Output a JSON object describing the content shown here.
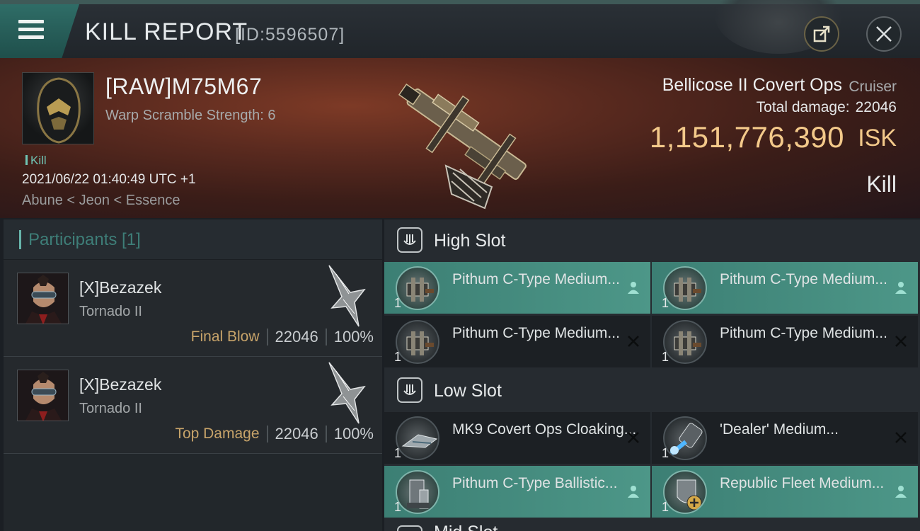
{
  "header": {
    "title": "KILL REPORT",
    "report_id": "[ID:5596507]",
    "menu_icon": "hamburger-icon",
    "share_icon": "share-icon",
    "close_icon": "close-icon"
  },
  "victim": {
    "name": "[RAW]M75M67",
    "warp_scramble": "Warp Scramble Strength: 6",
    "kill_tag": "Kill",
    "datetime": "2021/06/22 01:40:49 UTC +1",
    "corporation_path": "Abune < Jeon < Essence",
    "ship_name": "Bellicose II Covert Ops",
    "ship_class": "Cruiser",
    "total_damage_label": "Total damage:",
    "total_damage": "22046",
    "isk_value": "1,151,776,390",
    "isk_unit": "ISK",
    "result": "Kill"
  },
  "participants": {
    "header": "Participants [1]",
    "list": [
      {
        "name": "[X]Bezazek",
        "ship": "Tornado II",
        "role": "Final Blow",
        "damage": "22046",
        "percent": "100%"
      },
      {
        "name": "[X]Bezazek",
        "ship": "Tornado II",
        "role": "Top Damage",
        "damage": "22046",
        "percent": "100%"
      }
    ]
  },
  "fitting": {
    "high_slot": {
      "label": "High Slot",
      "modules": [
        {
          "name": "Pithum C-Type Medium...",
          "qty": "1",
          "state": "active",
          "icon": "turret-icon"
        },
        {
          "name": "Pithum C-Type Medium...",
          "qty": "1",
          "state": "active",
          "icon": "turret-icon"
        },
        {
          "name": "Pithum C-Type Medium...",
          "qty": "1",
          "state": "destroyed",
          "icon": "turret-icon"
        },
        {
          "name": "Pithum C-Type Medium...",
          "qty": "1",
          "state": "destroyed",
          "icon": "turret-icon"
        }
      ]
    },
    "low_slot": {
      "label": "Low Slot",
      "modules": [
        {
          "name": "MK9 Covert Ops Cloaking...",
          "qty": "1",
          "state": "destroyed",
          "icon": "cloak-icon"
        },
        {
          "name": "'Dealer' Medium...",
          "qty": "1",
          "state": "destroyed",
          "icon": "capacitor-icon"
        },
        {
          "name": "Pithum C-Type Ballistic...",
          "qty": "1",
          "state": "active",
          "icon": "ballistic-icon"
        },
        {
          "name": "Republic Fleet Medium...",
          "qty": "1",
          "state": "active",
          "icon": "armor-icon"
        }
      ]
    },
    "mid_slot": {
      "label": "Mid Slot"
    }
  },
  "colors": {
    "accent_teal": "#4d9788",
    "isk_gold": "#f3c98a",
    "role_gold": "#c8a46a",
    "kill_green": "#6fc4b4"
  }
}
